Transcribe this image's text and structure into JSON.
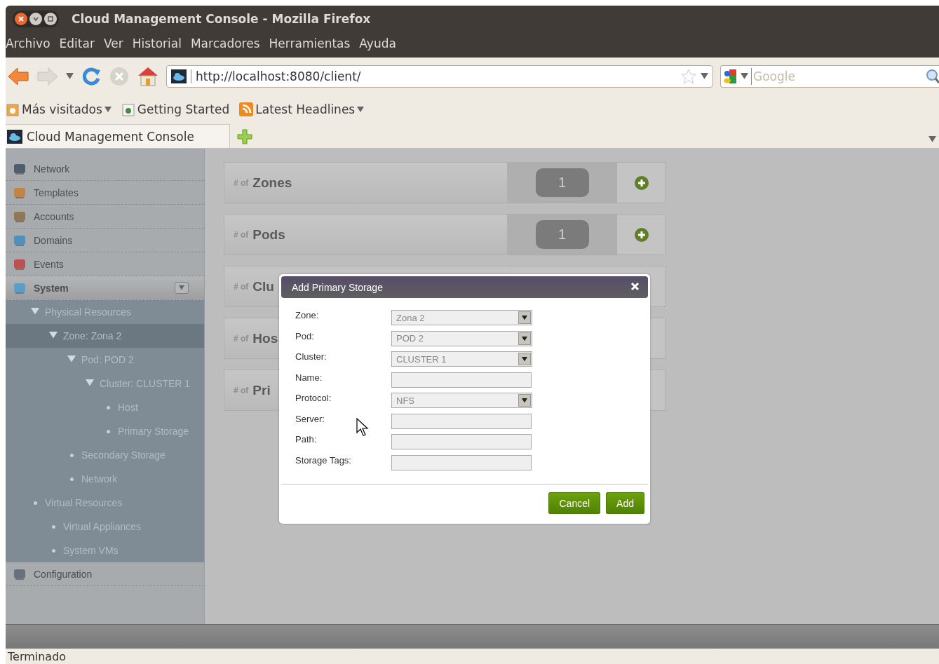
{
  "window": {
    "title": "Cloud Management Console - Mozilla Firefox"
  },
  "menu": [
    "Archivo",
    "Editar",
    "Ver",
    "Historial",
    "Marcadores",
    "Herramientas",
    "Ayuda"
  ],
  "navigation": {
    "url": "http://localhost:8080/client/",
    "search_placeholder": "Google"
  },
  "bookmarks": [
    {
      "label": "Más visitados",
      "dropdown": true
    },
    {
      "label": "Getting Started",
      "dropdown": false
    },
    {
      "label": "Latest Headlines",
      "dropdown": true
    }
  ],
  "tabs": [
    {
      "label": "Cloud Management Console",
      "selected": true
    }
  ],
  "sidebar": {
    "items": [
      {
        "label": "Network",
        "selected": false
      },
      {
        "label": "Templates",
        "selected": false
      },
      {
        "label": "Accounts",
        "selected": false
      },
      {
        "label": "Domains",
        "selected": false
      },
      {
        "label": "Events",
        "selected": false
      },
      {
        "label": "System",
        "selected": true,
        "expanded": true,
        "children": [
          {
            "label": "Physical Resources",
            "kind": "toggle",
            "expanded": true,
            "selected": false,
            "children": [
              {
                "label": "Zone: Zona 2",
                "kind": "toggle",
                "expanded": true,
                "selected": true,
                "children": [
                  {
                    "label": "Pod: POD 2",
                    "kind": "toggle",
                    "expanded": true,
                    "selected": false,
                    "children": [
                      {
                        "label": "Cluster: CLUSTER 1",
                        "kind": "toggle",
                        "expanded": true,
                        "selected": false,
                        "children": [
                          {
                            "label": "Host",
                            "kind": "bullet",
                            "selected": false
                          },
                          {
                            "label": "Primary Storage",
                            "kind": "bullet",
                            "selected": false
                          }
                        ]
                      }
                    ]
                  },
                  {
                    "label": "Secondary Storage",
                    "kind": "bullet",
                    "selected": false
                  },
                  {
                    "label": "Network",
                    "kind": "bullet",
                    "selected": false
                  }
                ]
              }
            ]
          },
          {
            "label": "Virtual Resources",
            "kind": "bullet",
            "selected": false,
            "children": [
              {
                "label": "Virtual Appliances",
                "kind": "bullet",
                "selected": false
              },
              {
                "label": "System VMs",
                "kind": "bullet",
                "selected": false
              }
            ]
          }
        ]
      },
      {
        "label": "Configuration",
        "selected": false
      }
    ]
  },
  "stats": [
    {
      "prefix": "# of",
      "title": "Zones",
      "count": "1"
    },
    {
      "prefix": "# of",
      "title": "Pods",
      "count": "1"
    },
    {
      "prefix": "# of",
      "title": "Clu"
    },
    {
      "prefix": "# of",
      "title": "Hos"
    },
    {
      "prefix": "# of",
      "title": "Pri"
    }
  ],
  "dialog": {
    "title": "Add Primary Storage",
    "fields": [
      {
        "label": "Zone:",
        "kind": "select",
        "value": "Zona 2"
      },
      {
        "label": "Pod:",
        "kind": "select",
        "value": "POD 2"
      },
      {
        "label": "Cluster:",
        "kind": "select",
        "value": "CLUSTER 1"
      },
      {
        "label": "Name:",
        "kind": "text"
      },
      {
        "label": "Protocol:",
        "kind": "select",
        "value": "NFS"
      },
      {
        "label": "Server:",
        "kind": "text"
      },
      {
        "label": "Path:",
        "kind": "text"
      },
      {
        "label": "Storage Tags:",
        "kind": "text"
      }
    ],
    "buttons": [
      "Cancel",
      "Add"
    ]
  },
  "status_bar": "Terminado"
}
